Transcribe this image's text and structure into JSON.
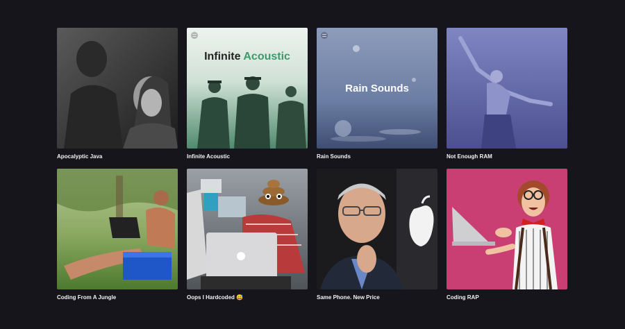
{
  "playlists": [
    {
      "title": "Apocalyptic Java"
    },
    {
      "title": "Infinite Acoustic",
      "cover_text_a": "Infinite",
      "cover_text_b": "Acoustic"
    },
    {
      "title": "Rain Sounds",
      "cover_text": "Rain Sounds"
    },
    {
      "title": "Not Enough RAM"
    },
    {
      "title": "Coding From A Jungle"
    },
    {
      "title": "Oops I Hardcoded 😅"
    },
    {
      "title": "Same Phone. New Price"
    },
    {
      "title": "Coding RAP"
    }
  ],
  "colors": {
    "background": "#17151c",
    "acoustic_green": "#3d9a6a"
  },
  "icons": [
    "spotify-logo-icon",
    "apple-logo-icon",
    "poop-emoji-icon"
  ]
}
